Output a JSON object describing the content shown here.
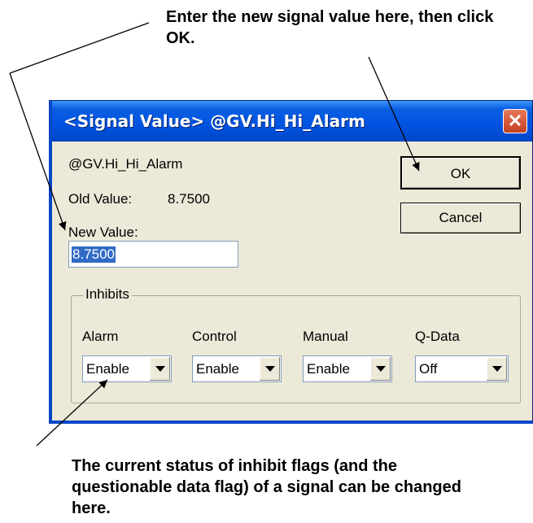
{
  "callouts": {
    "top": "Enter the new signal value here, then click OK.",
    "bottom": "The current status of inhibit flags (and the questionable data flag) of a signal can be changed here."
  },
  "dialog": {
    "title": "<Signal Value> @GV.Hi_Hi_Alarm",
    "signal_name": "@GV.Hi_Hi_Alarm",
    "old_value_label": "Old Value:",
    "old_value": "8.7500",
    "new_value_label": "New Value:",
    "new_value": "8.7500",
    "ok_label": "OK",
    "cancel_label": "Cancel",
    "close_glyph": "✕",
    "inhibits": {
      "legend": "Inhibits",
      "alarm": {
        "label": "Alarm",
        "value": "Enable"
      },
      "control": {
        "label": "Control",
        "value": "Enable"
      },
      "manual": {
        "label": "Manual",
        "value": "Enable"
      },
      "qdata": {
        "label": "Q-Data",
        "value": "Off"
      }
    }
  },
  "colors": {
    "titlebar": "#0054e3",
    "dialog_bg": "#ece9d8",
    "selection": "#316ac5",
    "close_button": "#c3401f"
  }
}
